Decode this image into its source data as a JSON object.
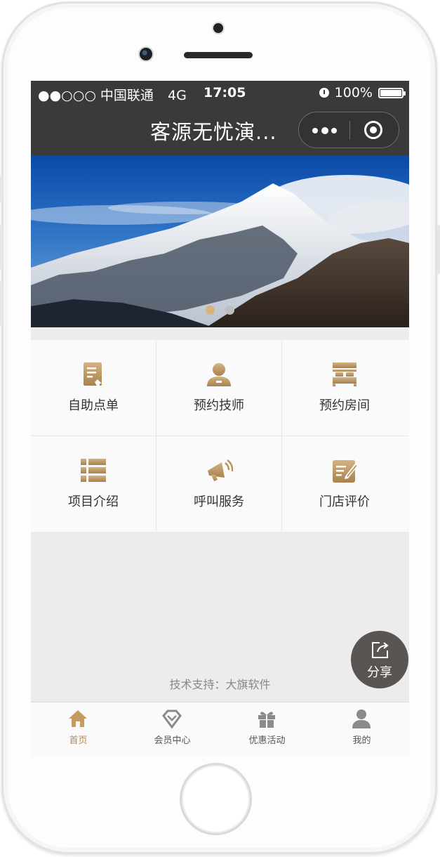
{
  "status_bar": {
    "carrier": "●●○○○ 中国联通",
    "network": "4G",
    "time": "17:05",
    "battery": "100%"
  },
  "nav": {
    "title": "客源无忧演..."
  },
  "banner": {
    "slide_count": 2,
    "active_slide": 1
  },
  "menu": {
    "items": [
      {
        "label": "自助点单",
        "icon": "order-icon"
      },
      {
        "label": "预约技师",
        "icon": "technician-icon"
      },
      {
        "label": "预约房间",
        "icon": "room-bed-icon"
      },
      {
        "label": "项目介绍",
        "icon": "list-icon"
      },
      {
        "label": "呼叫服务",
        "icon": "megaphone-icon"
      },
      {
        "label": "门店评价",
        "icon": "review-edit-icon"
      }
    ]
  },
  "footer": {
    "support_text": "技术支持：大旗软件"
  },
  "share": {
    "label": "分享"
  },
  "tabbar": {
    "tabs": [
      {
        "label": "首页",
        "icon": "home-icon",
        "active": true
      },
      {
        "label": "会员中心",
        "icon": "diamond-icon",
        "active": false
      },
      {
        "label": "优惠活动",
        "icon": "gift-icon",
        "active": false
      },
      {
        "label": "我的",
        "icon": "user-icon",
        "active": false
      }
    ]
  },
  "colors": {
    "accent_gold": "#b18a55",
    "bar_dark": "#3a3a3a",
    "share_bg": "#5a5552"
  }
}
